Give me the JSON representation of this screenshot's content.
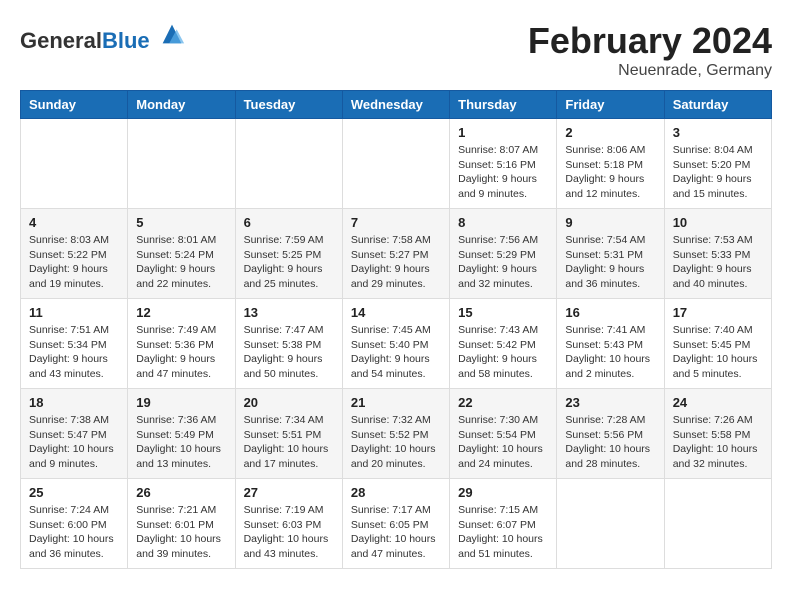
{
  "header": {
    "logo_general": "General",
    "logo_blue": "Blue",
    "title": "February 2024",
    "subtitle": "Neuenrade, Germany"
  },
  "weekdays": [
    "Sunday",
    "Monday",
    "Tuesday",
    "Wednesday",
    "Thursday",
    "Friday",
    "Saturday"
  ],
  "weeks": [
    [
      {
        "day": "",
        "info": ""
      },
      {
        "day": "",
        "info": ""
      },
      {
        "day": "",
        "info": ""
      },
      {
        "day": "",
        "info": ""
      },
      {
        "day": "1",
        "info": "Sunrise: 8:07 AM\nSunset: 5:16 PM\nDaylight: 9 hours\nand 9 minutes."
      },
      {
        "day": "2",
        "info": "Sunrise: 8:06 AM\nSunset: 5:18 PM\nDaylight: 9 hours\nand 12 minutes."
      },
      {
        "day": "3",
        "info": "Sunrise: 8:04 AM\nSunset: 5:20 PM\nDaylight: 9 hours\nand 15 minutes."
      }
    ],
    [
      {
        "day": "4",
        "info": "Sunrise: 8:03 AM\nSunset: 5:22 PM\nDaylight: 9 hours\nand 19 minutes."
      },
      {
        "day": "5",
        "info": "Sunrise: 8:01 AM\nSunset: 5:24 PM\nDaylight: 9 hours\nand 22 minutes."
      },
      {
        "day": "6",
        "info": "Sunrise: 7:59 AM\nSunset: 5:25 PM\nDaylight: 9 hours\nand 25 minutes."
      },
      {
        "day": "7",
        "info": "Sunrise: 7:58 AM\nSunset: 5:27 PM\nDaylight: 9 hours\nand 29 minutes."
      },
      {
        "day": "8",
        "info": "Sunrise: 7:56 AM\nSunset: 5:29 PM\nDaylight: 9 hours\nand 32 minutes."
      },
      {
        "day": "9",
        "info": "Sunrise: 7:54 AM\nSunset: 5:31 PM\nDaylight: 9 hours\nand 36 minutes."
      },
      {
        "day": "10",
        "info": "Sunrise: 7:53 AM\nSunset: 5:33 PM\nDaylight: 9 hours\nand 40 minutes."
      }
    ],
    [
      {
        "day": "11",
        "info": "Sunrise: 7:51 AM\nSunset: 5:34 PM\nDaylight: 9 hours\nand 43 minutes."
      },
      {
        "day": "12",
        "info": "Sunrise: 7:49 AM\nSunset: 5:36 PM\nDaylight: 9 hours\nand 47 minutes."
      },
      {
        "day": "13",
        "info": "Sunrise: 7:47 AM\nSunset: 5:38 PM\nDaylight: 9 hours\nand 50 minutes."
      },
      {
        "day": "14",
        "info": "Sunrise: 7:45 AM\nSunset: 5:40 PM\nDaylight: 9 hours\nand 54 minutes."
      },
      {
        "day": "15",
        "info": "Sunrise: 7:43 AM\nSunset: 5:42 PM\nDaylight: 9 hours\nand 58 minutes."
      },
      {
        "day": "16",
        "info": "Sunrise: 7:41 AM\nSunset: 5:43 PM\nDaylight: 10 hours\nand 2 minutes."
      },
      {
        "day": "17",
        "info": "Sunrise: 7:40 AM\nSunset: 5:45 PM\nDaylight: 10 hours\nand 5 minutes."
      }
    ],
    [
      {
        "day": "18",
        "info": "Sunrise: 7:38 AM\nSunset: 5:47 PM\nDaylight: 10 hours\nand 9 minutes."
      },
      {
        "day": "19",
        "info": "Sunrise: 7:36 AM\nSunset: 5:49 PM\nDaylight: 10 hours\nand 13 minutes."
      },
      {
        "day": "20",
        "info": "Sunrise: 7:34 AM\nSunset: 5:51 PM\nDaylight: 10 hours\nand 17 minutes."
      },
      {
        "day": "21",
        "info": "Sunrise: 7:32 AM\nSunset: 5:52 PM\nDaylight: 10 hours\nand 20 minutes."
      },
      {
        "day": "22",
        "info": "Sunrise: 7:30 AM\nSunset: 5:54 PM\nDaylight: 10 hours\nand 24 minutes."
      },
      {
        "day": "23",
        "info": "Sunrise: 7:28 AM\nSunset: 5:56 PM\nDaylight: 10 hours\nand 28 minutes."
      },
      {
        "day": "24",
        "info": "Sunrise: 7:26 AM\nSunset: 5:58 PM\nDaylight: 10 hours\nand 32 minutes."
      }
    ],
    [
      {
        "day": "25",
        "info": "Sunrise: 7:24 AM\nSunset: 6:00 PM\nDaylight: 10 hours\nand 36 minutes."
      },
      {
        "day": "26",
        "info": "Sunrise: 7:21 AM\nSunset: 6:01 PM\nDaylight: 10 hours\nand 39 minutes."
      },
      {
        "day": "27",
        "info": "Sunrise: 7:19 AM\nSunset: 6:03 PM\nDaylight: 10 hours\nand 43 minutes."
      },
      {
        "day": "28",
        "info": "Sunrise: 7:17 AM\nSunset: 6:05 PM\nDaylight: 10 hours\nand 47 minutes."
      },
      {
        "day": "29",
        "info": "Sunrise: 7:15 AM\nSunset: 6:07 PM\nDaylight: 10 hours\nand 51 minutes."
      },
      {
        "day": "",
        "info": ""
      },
      {
        "day": "",
        "info": ""
      }
    ]
  ]
}
